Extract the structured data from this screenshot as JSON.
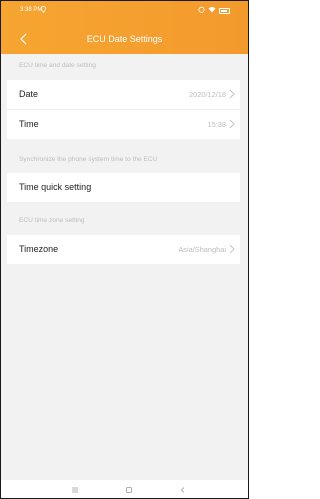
{
  "status_bar": {
    "time": "3:38 PM",
    "left_icon": "location-icon",
    "right_icons": [
      "alarm-icon",
      "wifi-icon",
      "battery-icon"
    ]
  },
  "header": {
    "title": "ECU Date Settings",
    "back_icon": "chevron-left-icon"
  },
  "sections": {
    "datetime_label": "ECU time and date setting",
    "sync_label": "Synchronize the phone system time to the ECU",
    "timezone_label": "ECU time zone setting"
  },
  "rows": {
    "date": {
      "label": "Date",
      "value": "2020/12/18"
    },
    "time": {
      "label": "Time",
      "value": "15:38"
    },
    "quick": {
      "label": "Time quick setting"
    },
    "timezone": {
      "label": "Timezone",
      "value": "Asia/Shanghai"
    }
  },
  "nav_bar": {
    "icons": [
      "menu-icon",
      "home-icon",
      "back-icon"
    ]
  },
  "colors": {
    "accent": "#f5a230",
    "background": "#f2f2f2",
    "section_text": "#bcbcbc",
    "value_text": "#bdbdbd"
  }
}
